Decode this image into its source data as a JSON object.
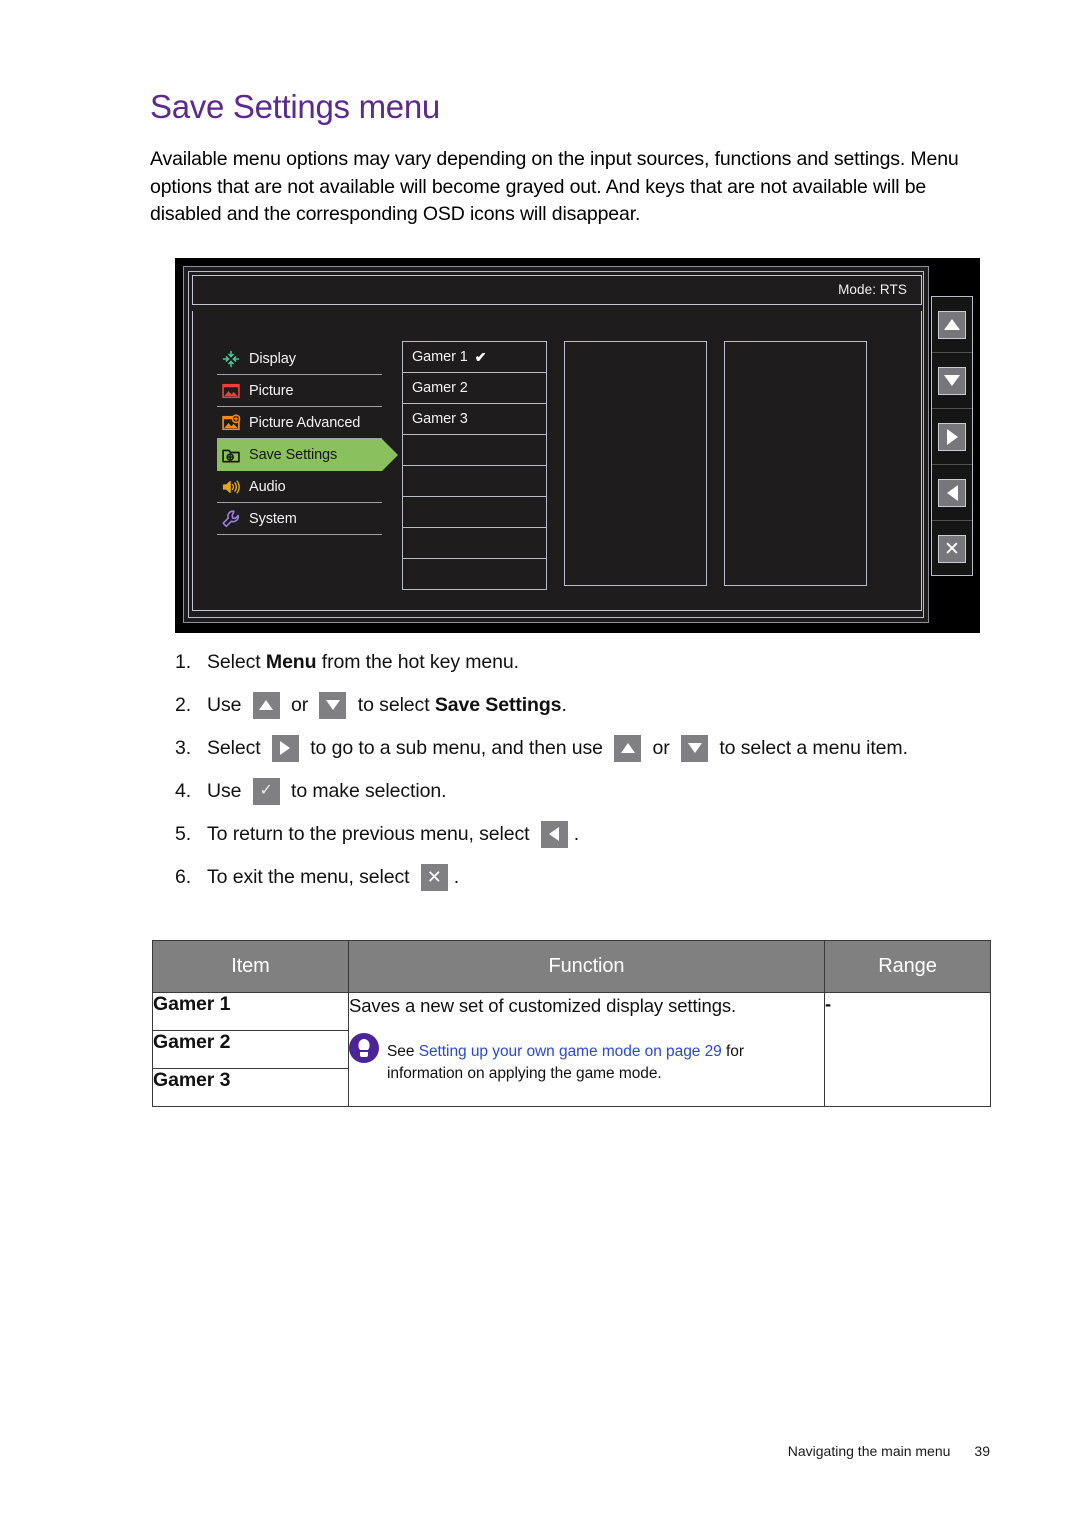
{
  "document": {
    "title": "Save Settings menu",
    "intro": "Available menu options may vary depending on the input sources, functions and settings. Menu options that are not available will become grayed out. And keys that are not available will be disabled and the corresponding OSD icons will disappear."
  },
  "osd": {
    "mode_label": "Mode: RTS",
    "menu_items": [
      {
        "label": "Display",
        "icon": "display-icon",
        "selected": false
      },
      {
        "label": "Picture",
        "icon": "picture-icon",
        "selected": false
      },
      {
        "label": "Picture Advanced",
        "icon": "picture-advanced-icon",
        "selected": false
      },
      {
        "label": "Save Settings",
        "icon": "save-settings-icon",
        "selected": true
      },
      {
        "label": "Audio",
        "icon": "audio-icon",
        "selected": false
      },
      {
        "label": "System",
        "icon": "system-icon",
        "selected": false
      }
    ],
    "submenu_items": [
      {
        "label": "Gamer 1",
        "checked": true
      },
      {
        "label": "Gamer 2",
        "checked": false
      },
      {
        "label": "Gamer 3",
        "checked": false
      },
      {
        "label": "",
        "checked": false
      },
      {
        "label": "",
        "checked": false
      },
      {
        "label": "",
        "checked": false
      },
      {
        "label": "",
        "checked": false
      },
      {
        "label": "",
        "checked": false
      }
    ],
    "keys": [
      {
        "icon": "arrow-up-icon"
      },
      {
        "icon": "arrow-down-icon"
      },
      {
        "icon": "arrow-right-icon"
      },
      {
        "icon": "arrow-left-icon"
      },
      {
        "icon": "close-x-icon"
      }
    ],
    "colors": {
      "highlight": "#8bc05f",
      "panel_bg": "#1e1c1c",
      "border": "#b8bcc7",
      "display_icon": "#4ec79a",
      "picture_icon": "#e8423a",
      "picture_advanced_icon": "#f08a20",
      "audio_icon": "#e5a817",
      "system_icon": "#9b7ede"
    }
  },
  "steps": [
    {
      "num": "1.",
      "parts": [
        {
          "t": "text",
          "v": "Select "
        },
        {
          "t": "bold",
          "v": "Menu"
        },
        {
          "t": "text",
          "v": " from the hot key menu."
        }
      ]
    },
    {
      "num": "2.",
      "parts": [
        {
          "t": "text",
          "v": "Use "
        },
        {
          "t": "icon",
          "v": "arrow-up-icon"
        },
        {
          "t": "text",
          "v": " or "
        },
        {
          "t": "icon",
          "v": "arrow-down-icon"
        },
        {
          "t": "text",
          "v": " to select "
        },
        {
          "t": "bold",
          "v": "Save Settings"
        },
        {
          "t": "text",
          "v": "."
        }
      ]
    },
    {
      "num": "3.",
      "parts": [
        {
          "t": "text",
          "v": "Select "
        },
        {
          "t": "icon",
          "v": "arrow-right-icon"
        },
        {
          "t": "text",
          "v": " to go to a sub menu, and then use "
        },
        {
          "t": "icon",
          "v": "arrow-up-icon"
        },
        {
          "t": "text",
          "v": " or "
        },
        {
          "t": "icon",
          "v": "arrow-down-icon"
        },
        {
          "t": "text",
          "v": " to select a menu item."
        }
      ]
    },
    {
      "num": "4.",
      "parts": [
        {
          "t": "text",
          "v": "Use "
        },
        {
          "t": "icon",
          "v": "check-icon"
        },
        {
          "t": "text",
          "v": " to make selection."
        }
      ]
    },
    {
      "num": "5.",
      "parts": [
        {
          "t": "text",
          "v": "To return to the previous menu, select "
        },
        {
          "t": "icon",
          "v": "arrow-left-icon"
        },
        {
          "t": "text",
          "v": "."
        }
      ]
    },
    {
      "num": "6.",
      "parts": [
        {
          "t": "text",
          "v": "To exit the menu, select "
        },
        {
          "t": "icon",
          "v": "close-x-icon"
        },
        {
          "t": "text",
          "v": "."
        }
      ]
    }
  ],
  "table": {
    "headers": [
      "Item",
      "Function",
      "Range"
    ],
    "items": [
      "Gamer 1",
      "Gamer 2",
      "Gamer 3"
    ],
    "function_text": "Saves a new set of customized display settings.",
    "note": {
      "icon": "tip-bulb-icon",
      "prefix": "See ",
      "link": "Setting up your own game mode on page 29",
      "suffix": " for information on applying the game mode."
    },
    "range": "-"
  },
  "footer": {
    "section": "Navigating the main menu",
    "page": "39"
  }
}
